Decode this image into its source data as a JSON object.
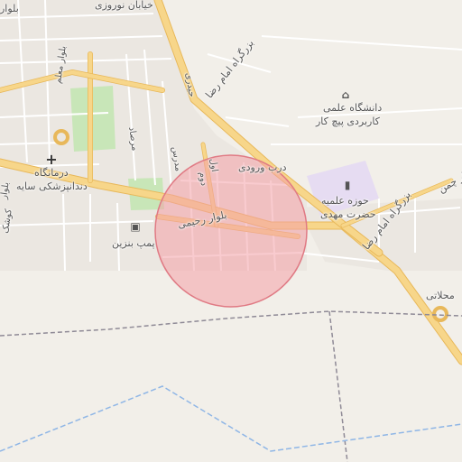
{
  "map": {
    "labels": {
      "blvd_top_left": "بلوار",
      "street_top": "خیابان نوروزی",
      "blvd_moalem": "بلوار معلم",
      "street_left_1": "سعدی",
      "street_moradi": "مرصاد",
      "street_madares": "مدرس",
      "street_dd1": "دوم",
      "street_dd2": "اول",
      "street_heydari": "حیدری",
      "highway_1": "بزرگراه امام رضا",
      "highway_2": "بزرگراه امام رضا",
      "univ_line1": "دانشگاه علمی",
      "univ_line2": "کاربردی پیچ کار",
      "darb": "درب ورودی",
      "clinic_line1": "درمانگاه",
      "clinic_line2": "دندانپزشکی سایه",
      "hawza_line1": "حوزه علمیه",
      "hawza_line2": "حضرت مهدی",
      "blvd_rahimi": "بلوار رحیمی",
      "fuel": "پمپ بنزین",
      "right_top": "بلوار چمن",
      "right_bottom": "محلاتی",
      "left_edge_1": "بلوار",
      "left_edge_2": "کوشک"
    },
    "icons": {
      "university": "graduation-cap-icon",
      "clinic": "plus-cross-icon",
      "hawza": "book-icon",
      "fuel": "fuel-pump-icon"
    },
    "colors": {
      "land": "#f2efe9",
      "major_road": "#f7d68a",
      "major_road_casing": "#e8b85a",
      "minor_road": "#ffffff",
      "park": "#c8e6b8",
      "campus": "#e6dcf2",
      "radius_fill": "#f4a0a8",
      "radius_stroke": "#e07a84",
      "admin_boundary": "#8f8a96",
      "water_boundary": "#8fb6e6"
    }
  }
}
